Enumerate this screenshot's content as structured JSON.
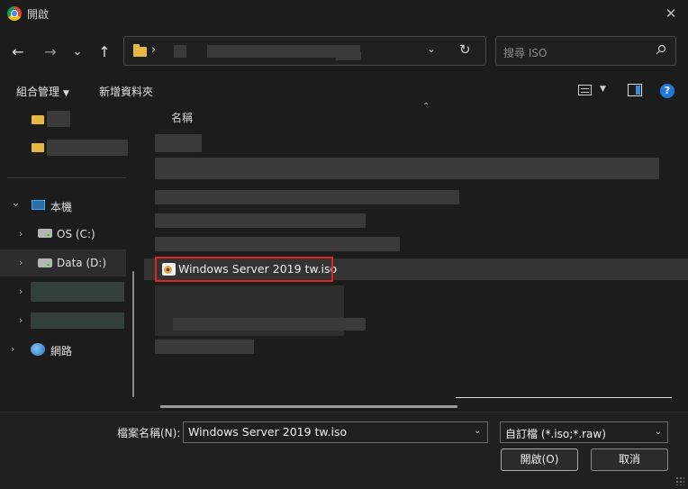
{
  "window": {
    "title": "開啟",
    "close_glyph": "✕"
  },
  "nav": {
    "back_glyph": "←",
    "forward_glyph": "→",
    "recent_glyph": "⌄",
    "up_glyph": "↑",
    "address_chevron": "›",
    "address_dropdown_glyph": "⌄",
    "refresh_glyph": "↻"
  },
  "search": {
    "placeholder": "搜尋 ISO"
  },
  "toolbar": {
    "organize_label": "組合管理",
    "organize_caret": "▼",
    "new_folder_label": "新增資料夾",
    "view_caret": "▼",
    "help_glyph": "?"
  },
  "sidebar": {
    "this_pc_label": "本機",
    "drive_c_label": "OS (C:)",
    "drive_d_label": "Data (D:)",
    "network_label": "網路",
    "expand_glyph": "›",
    "collapse_glyph": "⌄"
  },
  "files": {
    "column_name": "名稱",
    "sort_glyph": "⌃",
    "selected_file": "Windows Server 2019 tw.iso"
  },
  "footer": {
    "filename_label": "檔案名稱(N):",
    "filename_value": "Windows Server 2019 tw.iso",
    "dropdown_glyph": "⌄",
    "filetype_value": "自訂檔 (*.iso;*.raw)",
    "open_label": "開啟(O)",
    "cancel_label": "取消"
  },
  "colors": {
    "accent": "#1f7ae0",
    "highlight_border": "#e02424",
    "folder": "#e8b847"
  }
}
